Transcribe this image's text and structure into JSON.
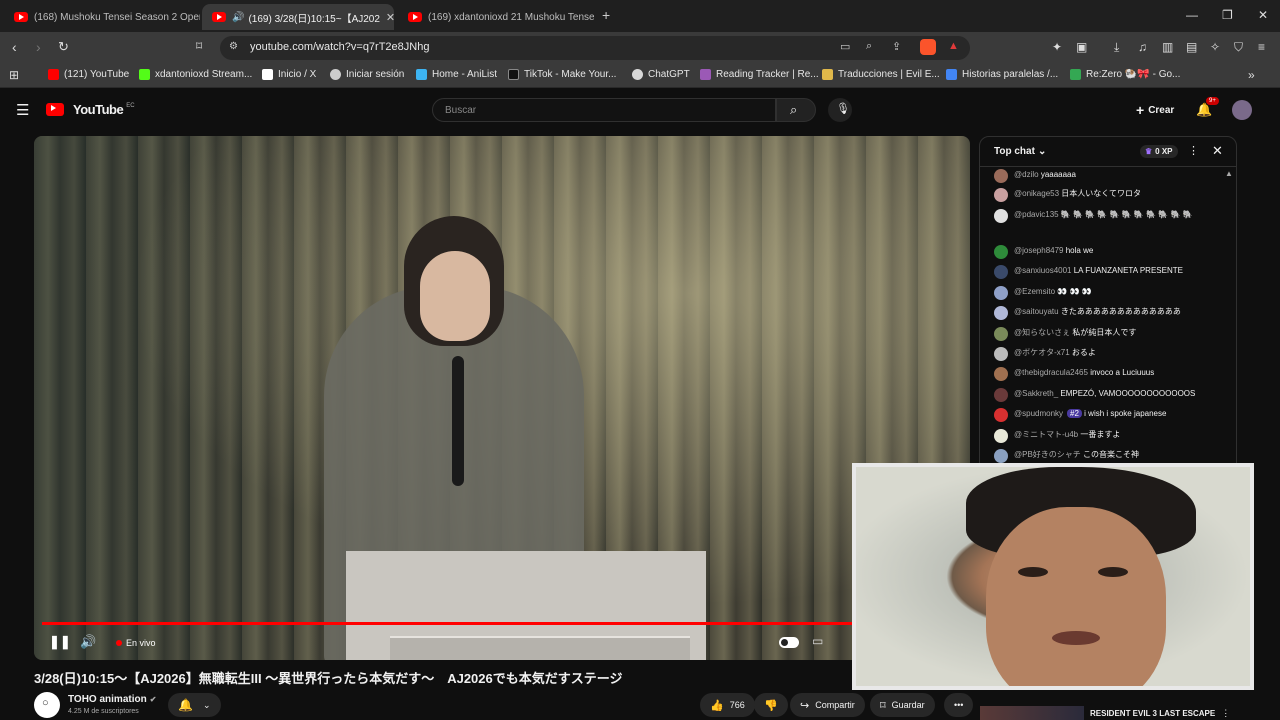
{
  "tabs": [
    {
      "title": "(168) Mushoku Tensei Season 2 Oper"
    },
    {
      "title": "(169) 3/28(日)10:15~【AJ202"
    },
    {
      "title": "(169) xdantonioxd 21 Mushoku Tensei"
    }
  ],
  "address": {
    "url": "youtube.com/watch?v=q7rT2e8JNhg"
  },
  "bookmarks": [
    {
      "label": "(121) YouTube",
      "color": "#ff0000"
    },
    {
      "label": "xdantonioxd Stream...",
      "color": "#53fc18"
    },
    {
      "label": "Inicio / X",
      "color": "#ffffff"
    },
    {
      "label": "Iniciar sesión",
      "color": "#cccccc"
    },
    {
      "label": "Home - AniList",
      "color": "#3db4f2"
    },
    {
      "label": "TikTok - Make Your...",
      "color": "#111111"
    },
    {
      "label": "ChatGPT",
      "color": "#d8d8d8"
    },
    {
      "label": "Reading Tracker | Re...",
      "color": "#9b59b6"
    },
    {
      "label": "Traducciones | Evil E...",
      "color": "#e0b84a"
    },
    {
      "label": "Historias paralelas /...",
      "color": "#4285f4"
    },
    {
      "label": "Re:Zero 🐏🎀 - Go...",
      "color": "#34a853"
    }
  ],
  "youtube": {
    "logo": "YouTube",
    "region": "EC",
    "search_placeholder": "Buscar",
    "create_label": "Crear",
    "notif_count": "9+"
  },
  "player": {
    "live_label": "En vivo",
    "progress": 1.0
  },
  "chat": {
    "mode_label": "Top chat",
    "xp_label": "0 XP",
    "messages": [
      {
        "author": "@dzilo",
        "text": "yaaaaaaa",
        "color": "#9a6b5a"
      },
      {
        "author": "@onikage53",
        "text": "日本人いなくてワロタ",
        "color": "#c9a0a0"
      },
      {
        "author": "@pdavic135",
        "text": "🐘 🐘 🐘 🐘 🐘 🐘 🐘 🐘 🐘 🐘 🐘",
        "color": "#e0e0e0"
      },
      {
        "author": "@joseph8479",
        "text": "hola we",
        "color": "#2e8b3a"
      },
      {
        "author": "@sanxiuos4001",
        "text": "LA FUANZANETA PRESENTE",
        "color": "#3a4a6a"
      },
      {
        "author": "@Ezemsito",
        "text": "👀 👀 👀",
        "color": "#8fa0c8"
      },
      {
        "author": "@saitouyatu",
        "text": "きたあああああああああああああ",
        "color": "#b0b8d8"
      },
      {
        "author": "@知らないさぇ",
        "text": "私が純日本人です",
        "color": "#7a8a5a"
      },
      {
        "author": "@ボケオタ-x71",
        "text": "おるよ",
        "color": "#bbbbbb"
      },
      {
        "author": "@thebigdracula2465",
        "text": "invoco a Luciuuus",
        "color": "#a07050"
      },
      {
        "author": "@Sakkreth_",
        "text": "EMPEZÓ, VAMOOOOOOOOOOOOS",
        "color": "#6a3a3a"
      },
      {
        "author": "@spudmonky",
        "badge": "#2",
        "text": "i wish i spoke japanese",
        "color": "#d83030"
      },
      {
        "author": "@ミニトマト-u4b",
        "text": "一番ますよ",
        "color": "#e8e8d8"
      },
      {
        "author": "@PB好きのシャチ",
        "text": "この音楽こそ神",
        "color": "#8aa0c0"
      }
    ]
  },
  "video": {
    "title": "3/28(日)10:15～【AJ2026】無職転生III ～異世界行ったら本気だす～　AJ2026でも本気だすステージ",
    "channel": "TOHO animation",
    "subscribers": "4.25 M de suscriptores",
    "likes": "766",
    "share_label": "Compartir",
    "save_label": "Guardar"
  },
  "sidebar_next": {
    "title": "RESIDENT EVIL 3 LAST ESCAPE"
  }
}
